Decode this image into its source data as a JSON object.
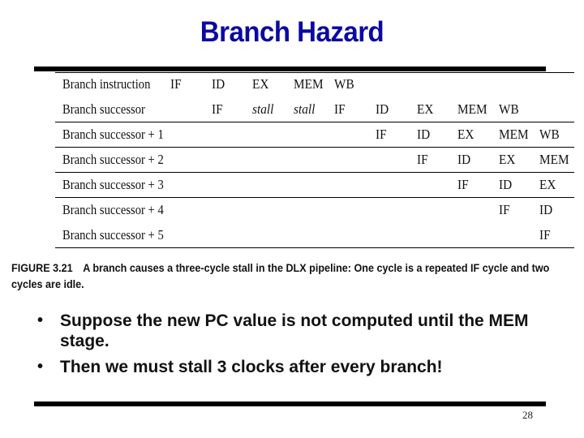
{
  "slide": {
    "title": "Branch Hazard",
    "page_number": "28"
  },
  "figure": {
    "rows": [
      {
        "label": "Branch instruction",
        "cells": [
          "IF",
          "ID",
          "EX",
          "MEM",
          "WB",
          "",
          "",
          "",
          "",
          ""
        ]
      },
      {
        "label": "Branch successor",
        "cells": [
          "",
          "IF",
          "stall",
          "stall",
          "IF",
          "ID",
          "EX",
          "MEM",
          "WB",
          ""
        ]
      },
      {
        "label": "Branch successor + 1",
        "cells": [
          "",
          "",
          "",
          "",
          "",
          "IF",
          "ID",
          "EX",
          "MEM",
          "WB"
        ]
      },
      {
        "label": "Branch successor + 2",
        "cells": [
          "",
          "",
          "",
          "",
          "",
          "",
          "IF",
          "ID",
          "EX",
          "MEM"
        ]
      },
      {
        "label": "Branch successor + 3",
        "cells": [
          "",
          "",
          "",
          "",
          "",
          "",
          "",
          "IF",
          "ID",
          "EX"
        ]
      },
      {
        "label": "Branch successor + 4",
        "cells": [
          "",
          "",
          "",
          "",
          "",
          "",
          "",
          "",
          "IF",
          "ID"
        ]
      },
      {
        "label": "Branch successor + 5",
        "cells": [
          "",
          "",
          "",
          "",
          "",
          "",
          "",
          "",
          "",
          "IF"
        ]
      }
    ],
    "caption_number": "FIGURE 3.21",
    "caption_text": "A branch causes a three-cycle stall in the DLX pipeline: One cycle is a repeated IF cycle and two cycles are idle."
  },
  "bullets": [
    "Suppose the new PC value is not computed until the MEM stage.",
    "Then we must stall 3 clocks after every branch!"
  ],
  "bullet_glyph": "•"
}
